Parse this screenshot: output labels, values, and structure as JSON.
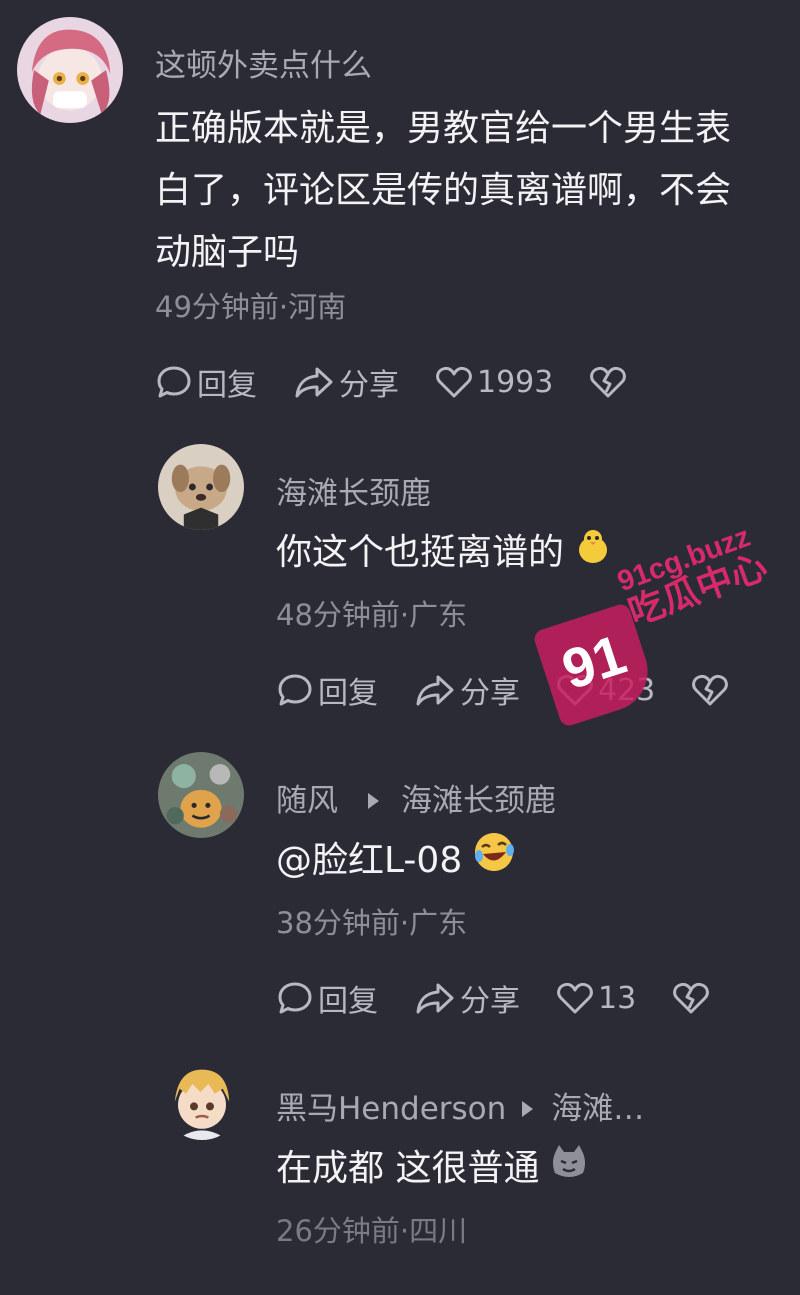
{
  "comments": [
    {
      "username": "这顿外卖点什么",
      "text": "正确版本就是，男教官给一个男生表白了，评论区是传的真离谱啊，不会动脑子吗",
      "text_lines": [
        "正确版本就是，男教官给一个男生表",
        "白了，评论区是传的真离谱啊，不会",
        "动脑子吗"
      ],
      "meta": "49分钟前·河南",
      "reply_label": "回复",
      "share_label": "分享",
      "like_count": "1993",
      "avatar_icon": "anime-girl-avatar-icon"
    },
    {
      "username": "海滩长颈鹿",
      "text": "你这个也挺离谱的",
      "emoji_icon": "chick-emoji-icon",
      "meta": "48分钟前·广东",
      "reply_label": "回复",
      "share_label": "分享",
      "like_count": "423",
      "avatar_icon": "puppy-avatar-icon"
    },
    {
      "username": "随风",
      "reply_to": "海滩长颈鹿",
      "text": "@脸红L-08",
      "emoji_icon": "laughing-crying-emoji-icon",
      "meta": "38分钟前·广东",
      "reply_label": "回复",
      "share_label": "分享",
      "like_count": "13",
      "avatar_icon": "cartoon-avatar-icon"
    },
    {
      "username": "黑马Henderson",
      "reply_to": "海滩…",
      "text": "在成都 这很普通",
      "emoji_icon": "cat-emoji-icon",
      "meta": "26分钟前·四川",
      "avatar_icon": "anime-boy-avatar-icon"
    }
  ],
  "watermark": {
    "number": "91",
    "url": "91cg.buzz",
    "name": "吃瓜中心"
  },
  "colors": {
    "background": "#2b2b35",
    "primary_text": "#f3f3f5",
    "secondary_text": "#a9a9b3",
    "meta_text": "#8e8e98",
    "watermark": "#c81e5e"
  }
}
